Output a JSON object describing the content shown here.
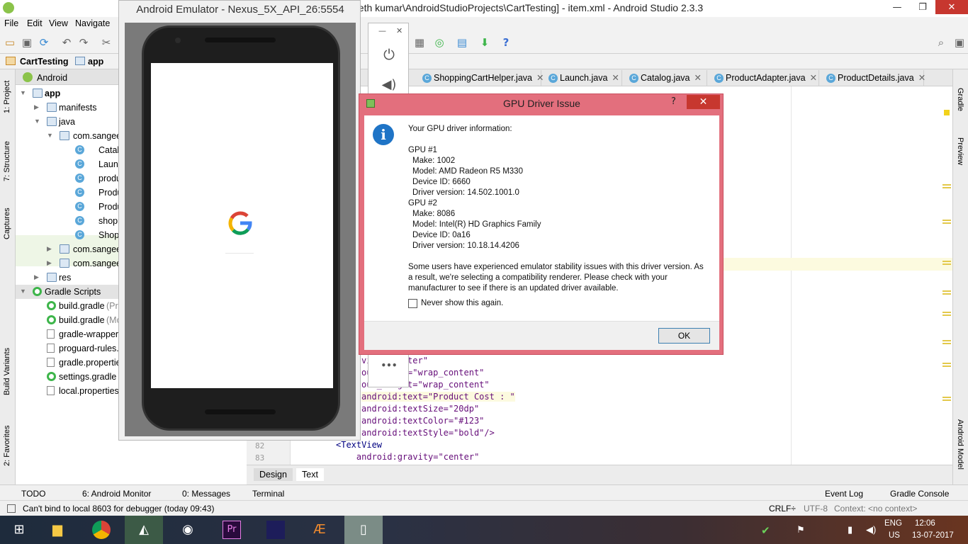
{
  "window": {
    "title": "eeth kumar\\AndroidStudioProjects\\CartTesting] - item.xml - Android Studio 2.3.3",
    "min": "—",
    "max": "❐",
    "close": "✕"
  },
  "menu": [
    "File",
    "Edit",
    "View",
    "Navigate"
  ],
  "breadcrumb": [
    "CartTesting",
    "app"
  ],
  "left_stripe": [
    "1: Project",
    "7: Structure",
    "Captures",
    "Build Variants",
    "2: Favorites"
  ],
  "right_stripe": [
    "Gradle",
    "Preview",
    "Android Model"
  ],
  "project": {
    "view": "Android",
    "tree": [
      {
        "label": "app",
        "bold": true
      },
      {
        "label": "manifests"
      },
      {
        "label": "java"
      },
      {
        "label": "com.sangee"
      },
      {
        "label": "Catal"
      },
      {
        "label": "Launc"
      },
      {
        "label": "produ"
      },
      {
        "label": "Produ"
      },
      {
        "label": "Produ"
      },
      {
        "label": "shopp"
      },
      {
        "label": "Shop"
      },
      {
        "label": "com.sangee"
      },
      {
        "label": "com.sangee"
      },
      {
        "label": "res"
      },
      {
        "label": "Gradle Scripts"
      },
      {
        "label": "build.gradle",
        "suffix": "(Pro"
      },
      {
        "label": "build.gradle",
        "suffix": "(Mo"
      },
      {
        "label": "gradle-wrapper."
      },
      {
        "label": "proguard-rules.p"
      },
      {
        "label": "gradle.propertie"
      },
      {
        "label": "settings.gradle",
        "suffix": "("
      },
      {
        "label": "local.properties"
      }
    ]
  },
  "editor_tabs": [
    "ShoppingCartHelper.java",
    "Launch.java",
    "Catalog.java",
    "ProductAdapter.java",
    "ProductDetails.java"
  ],
  "code": [
    {
      "ln": "",
      "text": "vity=\"center\""
    },
    {
      "ln": "",
      "text": "out_width=\"wrap_content\""
    },
    {
      "ln": "",
      "text": "out_height=\"wrap_content\""
    },
    {
      "ln": "",
      "text": "android:text=\"Product Cost : \""
    },
    {
      "ln": "",
      "text": "android:textSize=\"20dp\""
    },
    {
      "ln": "",
      "text": "android:textColor=\"#123\""
    },
    {
      "ln": "",
      "text": "android:textStyle=\"bold\"/>"
    },
    {
      "ln": "82",
      "text": "<TextView"
    },
    {
      "ln": "83",
      "text": "    android:gravity=\"center\""
    }
  ],
  "editor_bottom_tabs": [
    "Design",
    "Text"
  ],
  "tool_tabs": {
    "todo": "TODO",
    "monitor": "6: Android Monitor",
    "messages": "0: Messages",
    "terminal": "Terminal",
    "eventlog": "Event Log",
    "gradleconsole": "Gradle Console"
  },
  "status": {
    "message": "Can't bind to local 8603 for debugger (today 09:43)",
    "crlf": "CRLF÷",
    "encoding": "UTF-8",
    "context": "Context: <no context>"
  },
  "emulator": {
    "title": "Android Emulator - Nexus_5X_API_26:5554",
    "more": "•••"
  },
  "dialog": {
    "title": "GPU Driver Issue",
    "help": "?",
    "close": "✕",
    "icon": "i",
    "lines": [
      "Your GPU driver information:",
      "",
      "GPU #1",
      "  Make: 1002",
      "  Model: AMD Radeon R5 M330",
      "  Device ID: 6660",
      "  Driver version: 14.502.1001.0",
      "GPU #2",
      "  Make: 8086",
      "  Model: Intel(R) HD Graphics Family",
      "  Device ID: 0a16",
      "  Driver version: 10.18.14.4206",
      "",
      "Some users have experienced emulator stability issues with this driver version.  As",
      "a result, we're selecting a compatibility renderer.  Please check with your",
      "manufacturer to see if there is an updated driver available."
    ],
    "checkbox": "Never show this again.",
    "ok": "OK"
  },
  "tray": {
    "lang1": "ENG",
    "lang2": "US",
    "time": "12:06",
    "date": "13-07-2017"
  },
  "colors": {
    "dialog_border": "#e36f7d",
    "accent": "#1f74c6"
  }
}
